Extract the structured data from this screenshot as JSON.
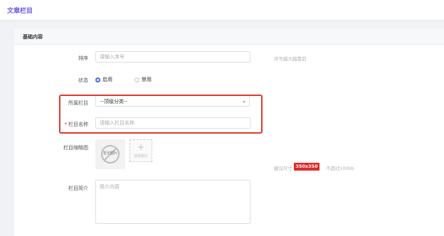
{
  "page": {
    "title": "文章栏目"
  },
  "section": {
    "title": "基础内容"
  },
  "form": {
    "sort": {
      "label": "排序",
      "placeholder": "请输入序号",
      "hint": "序号越大越靠前"
    },
    "status": {
      "label": "状态",
      "options": [
        "启用",
        "禁用"
      ],
      "selected": "启用"
    },
    "parent": {
      "label": "所属栏目",
      "value": "--顶级分类--"
    },
    "name": {
      "required_mark": "*",
      "label": "栏目名称",
      "placeholder": "请输入栏目名称"
    },
    "thumbnail": {
      "label": "栏目缩略图",
      "no_image_text": "暂无图片",
      "upload_plus": "+",
      "upload_text": "选择图片",
      "hint_prefix": "建议尺寸",
      "size": "350x350",
      "hint_suffix": "不超过100kb"
    },
    "intro": {
      "label": "栏目简介",
      "placeholder": "简介内容"
    }
  },
  "colors": {
    "accent": "#6b5ce7",
    "highlight": "#e03a2f",
    "size_badge": "#e02a2a",
    "radio_on": "#3f6ad8"
  }
}
